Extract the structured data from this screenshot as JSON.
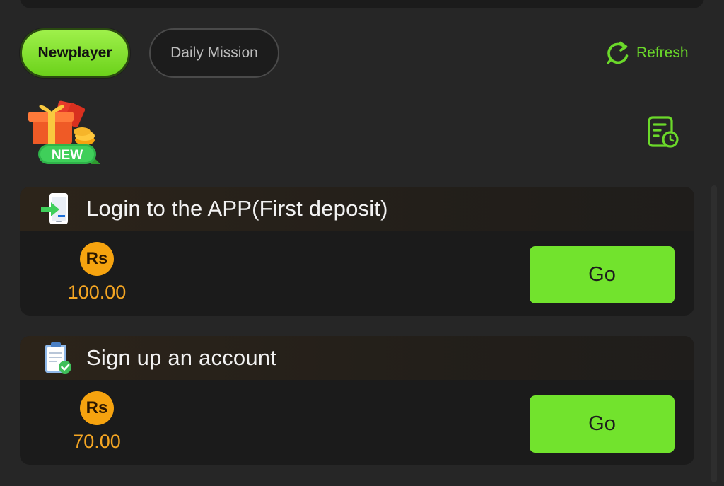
{
  "tabs": {
    "newplayer": "Newplayer",
    "daily_mission": "Daily Mission"
  },
  "refresh_label": "Refresh",
  "badge_text": "NEW",
  "tasks": [
    {
      "title": "Login to the APP(First deposit)",
      "currency": "Rs",
      "amount": "100.00",
      "button": "Go",
      "icon": "phone-login-icon"
    },
    {
      "title": "Sign up an account",
      "currency": "Rs",
      "amount": "70.00",
      "button": "Go",
      "icon": "clipboard-check-icon"
    }
  ],
  "colors": {
    "accent": "#72e32d",
    "reward": "#f5a623",
    "background": "#262626",
    "card": "#1b1b1b"
  }
}
